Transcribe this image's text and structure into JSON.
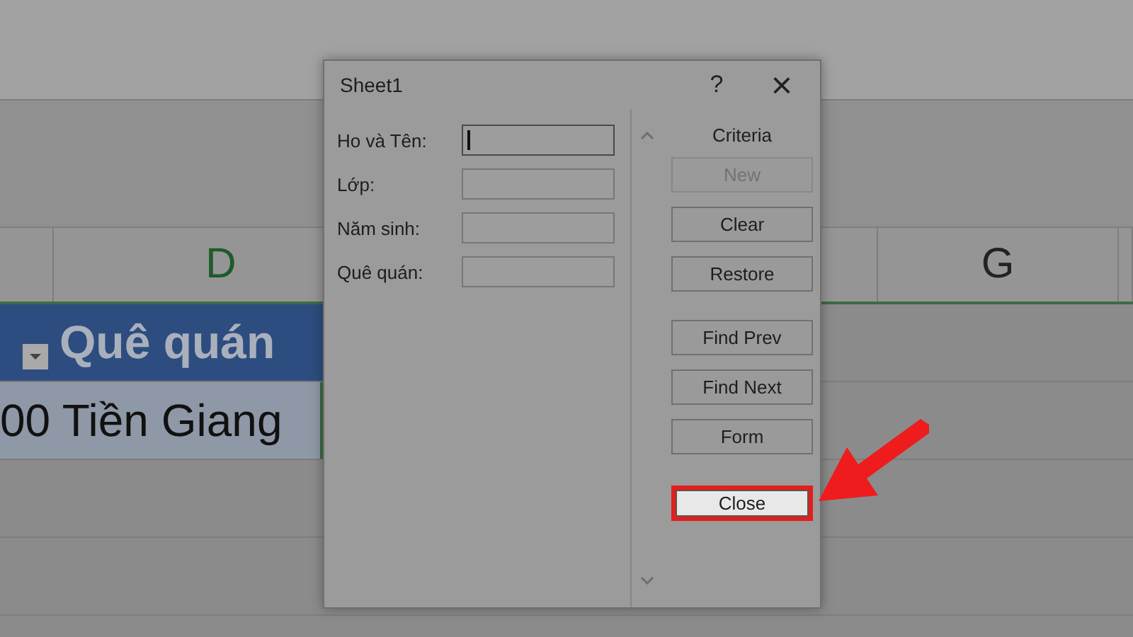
{
  "sheet": {
    "column_headers": [
      {
        "label": "D",
        "selected": true
      },
      {
        "label": "G",
        "selected": false
      }
    ],
    "table": {
      "header": "Quê quán",
      "value": "00 Tiền Giang"
    }
  },
  "dialog": {
    "title": "Sheet1",
    "help": "?",
    "close": "×",
    "fields": [
      {
        "label": "Ho và Tên:",
        "focused": true
      },
      {
        "label": "Lớp:",
        "focused": false
      },
      {
        "label": "Năm sinh:",
        "focused": false
      },
      {
        "label": "Quê quán:",
        "focused": false
      }
    ],
    "record_label": "Criteria",
    "button_groups": [
      [
        {
          "label": "New",
          "disabled": true,
          "highlighted": false
        },
        {
          "label": "Clear",
          "disabled": false,
          "highlighted": false
        },
        {
          "label": "Restore",
          "disabled": false,
          "highlighted": false
        }
      ],
      [
        {
          "label": "Find Prev",
          "disabled": false,
          "highlighted": false
        },
        {
          "label": "Find Next",
          "disabled": false,
          "highlighted": false
        },
        {
          "label": "Form",
          "disabled": false,
          "highlighted": false
        }
      ],
      [
        {
          "label": "Close",
          "disabled": false,
          "highlighted": true
        }
      ]
    ]
  }
}
